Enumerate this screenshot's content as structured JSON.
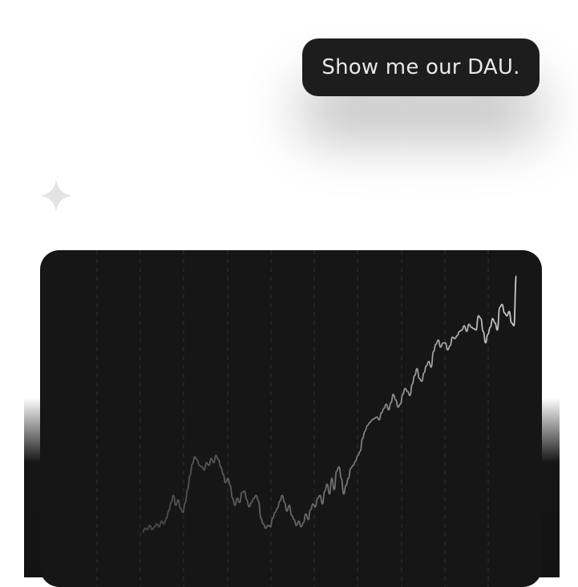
{
  "conversation": {
    "user_message": "Show me our DAU.",
    "assistant_icon": "sparkle-icon"
  },
  "colors": {
    "bubble_bg": "#1d1d1d",
    "bubble_text": "#e8e8e8",
    "chart_bg": "#161616",
    "line": "#8a8a8a",
    "grid": "#2e2e2e",
    "icon": "#e3e3e3"
  },
  "chart_data": {
    "type": "line",
    "title": "",
    "xlabel": "",
    "ylabel": "",
    "grid": "vertical dashed",
    "legend": "none",
    "ylim": [
      0,
      100
    ],
    "series": [
      {
        "values": [
          0,
          3,
          2,
          5,
          2,
          4,
          6,
          4,
          8,
          6,
          10,
          15,
          21,
          26,
          19,
          23,
          17,
          14,
          21,
          30,
          40,
          48,
          53,
          51,
          47,
          46,
          44,
          49,
          47,
          52,
          49,
          54,
          51,
          46,
          41,
          35,
          38,
          33,
          24,
          19,
          24,
          21,
          28,
          29,
          23,
          18,
          21,
          24,
          26,
          22,
          10,
          6,
          3,
          5,
          4,
          10,
          14,
          17,
          22,
          26,
          21,
          15,
          19,
          12,
          9,
          5,
          8,
          4,
          7,
          13,
          9,
          16,
          20,
          18,
          24,
          26,
          20,
          29,
          34,
          27,
          38,
          30,
          43,
          46,
          38,
          27,
          33,
          38,
          45,
          47,
          50,
          54,
          57,
          66,
          71,
          75,
          77,
          79,
          80,
          81,
          79,
          84,
          87,
          90,
          86,
          91,
          97,
          93,
          88,
          90,
          97,
          101,
          99,
          96,
          104,
          110,
          115,
          108,
          106,
          112,
          117,
          120,
          116,
          127,
          132,
          135,
          130,
          133,
          133,
          128,
          131,
          137,
          136,
          138,
          141,
          142,
          145,
          141,
          146,
          144,
          143,
          142,
          152,
          150,
          141,
          133,
          139,
          144,
          150,
          147,
          142,
          158,
          160,
          154,
          152,
          155,
          147,
          145,
          180
        ]
      }
    ]
  }
}
